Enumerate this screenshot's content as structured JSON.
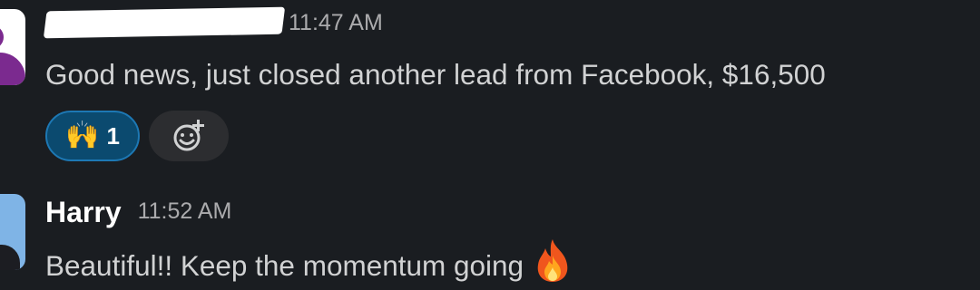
{
  "messages": [
    {
      "sender": "",
      "time": "11:47 AM",
      "text": "Good news, just closed another lead from Facebook, $16,500",
      "reactions": [
        {
          "emoji": "🙌",
          "emoji_name": "raised-hands",
          "count": "1",
          "active": true
        }
      ]
    },
    {
      "sender": "Harry",
      "time": "11:52 AM",
      "text": "Beautiful!! Keep the momentum going",
      "emoji_icon": "fire-icon"
    }
  ],
  "icons": {
    "add_reaction": "add-reaction-icon"
  },
  "colors": {
    "background": "#1a1d21",
    "text": "#d1d2d3",
    "timestamp": "#ababad",
    "active_reaction_bg": "#0b4a6f",
    "active_reaction_border": "#1d78b4",
    "add_reaction_bg": "#2c2d30"
  }
}
